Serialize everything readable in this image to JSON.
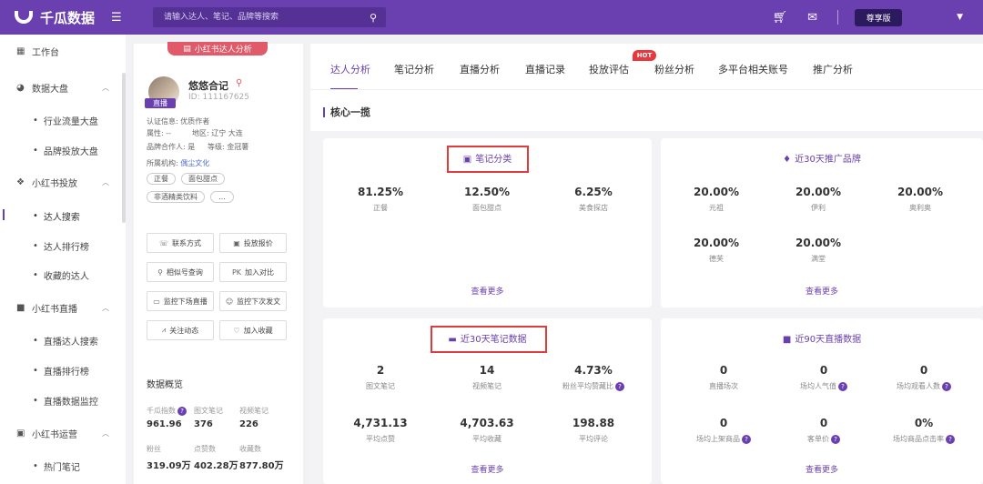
{
  "app": {
    "name": "千瓜数据",
    "plan": "尊享版"
  },
  "search": {
    "placeholder": "请输入达人、笔记、品牌等搜索"
  },
  "sidebar": {
    "groups": [
      {
        "label": "工作台",
        "icon": "grid-icon"
      },
      {
        "label": "数据大盘",
        "icon": "pie-icon"
      },
      {
        "label": "小红书投放",
        "icon": "cube-icon"
      },
      {
        "label": "小红书直播",
        "icon": "camera-icon"
      },
      {
        "label": "小红书运营",
        "icon": "chat-icon"
      }
    ],
    "items": [
      "行业流量大盘",
      "品牌投放大盘",
      "达人搜索",
      "达人排行榜",
      "收藏的达人",
      "直播达人搜索",
      "直播排行榜",
      "直播数据监控",
      "热门笔记"
    ]
  },
  "profile": {
    "pill": "小红书达人分析",
    "live_badge": "直播",
    "nickname": "悠悠合记",
    "id": "ID: 111167625",
    "cert": "认证信息: 优质作者",
    "attr_label": "属性: --",
    "region": "地区: 辽宁 大连",
    "brand_partner": "品牌合作人: 是",
    "level": "等级: 金冠薯",
    "org_label": "所属机构:",
    "org_value": "偶尘文化",
    "tags": [
      "正餐",
      "面包甜点",
      "非酒精类饮料",
      "..."
    ],
    "actions": [
      "联系方式",
      "投放报价",
      "相似号查询",
      "加入对比",
      "监控下场直播",
      "监控下次发文",
      "关注动态",
      "加入收藏"
    ],
    "overview_title": "数据概览",
    "overview": [
      {
        "label": "千瓜指数",
        "value": "961.96"
      },
      {
        "label": "图文笔记",
        "value": "376"
      },
      {
        "label": "视频笔记",
        "value": "226"
      },
      {
        "label": "粉丝",
        "value": "319.09万"
      },
      {
        "label": "点赞数",
        "value": "402.28万"
      },
      {
        "label": "收藏数",
        "value": "877.80万"
      }
    ]
  },
  "tabs": [
    "达人分析",
    "笔记分析",
    "直播分析",
    "直播记录",
    "投放评估",
    "粉丝分析",
    "多平台相关账号",
    "推广分析"
  ],
  "hot_badge": "HOT",
  "section_title": "核心一揽",
  "cards": {
    "note_category": {
      "title": "笔记分类",
      "metrics": [
        {
          "value": "81.25%",
          "label": "正餐"
        },
        {
          "value": "12.50%",
          "label": "面包甜点"
        },
        {
          "value": "6.25%",
          "label": "美食探店"
        }
      ],
      "more": "查看更多"
    },
    "brand_30d": {
      "title": "近30天推广品牌",
      "metrics": [
        {
          "value": "20.00%",
          "label": "元祖"
        },
        {
          "value": "20.00%",
          "label": "伊利"
        },
        {
          "value": "20.00%",
          "label": "奥利奥"
        },
        {
          "value": "20.00%",
          "label": "德芙"
        },
        {
          "value": "20.00%",
          "label": "满堂"
        }
      ],
      "more": "查看更多"
    },
    "notes_30d": {
      "title": "近30天笔记数据",
      "metrics": [
        {
          "value": "2",
          "label": "图文笔记"
        },
        {
          "value": "14",
          "label": "视频笔记"
        },
        {
          "value": "4.73%",
          "label": "粉丝平均赞藏比"
        },
        {
          "value": "4,731.13",
          "label": "平均点赞"
        },
        {
          "value": "4,703.63",
          "label": "平均收藏"
        },
        {
          "value": "198.88",
          "label": "平均评论"
        }
      ],
      "more": "查看更多"
    },
    "live_90d": {
      "title": "近90天直播数据",
      "metrics": [
        {
          "value": "0",
          "label": "直播场次"
        },
        {
          "value": "0",
          "label": "场均人气值"
        },
        {
          "value": "0",
          "label": "场均观看人数"
        },
        {
          "value": "0",
          "label": "场均上架商品"
        },
        {
          "value": "0",
          "label": "客单价"
        },
        {
          "value": "0%",
          "label": "场均商品点击率"
        }
      ],
      "more": "查看更多"
    }
  },
  "colors": {
    "brand": "#6a3fb0",
    "highlight_border": "#e03c3c"
  }
}
